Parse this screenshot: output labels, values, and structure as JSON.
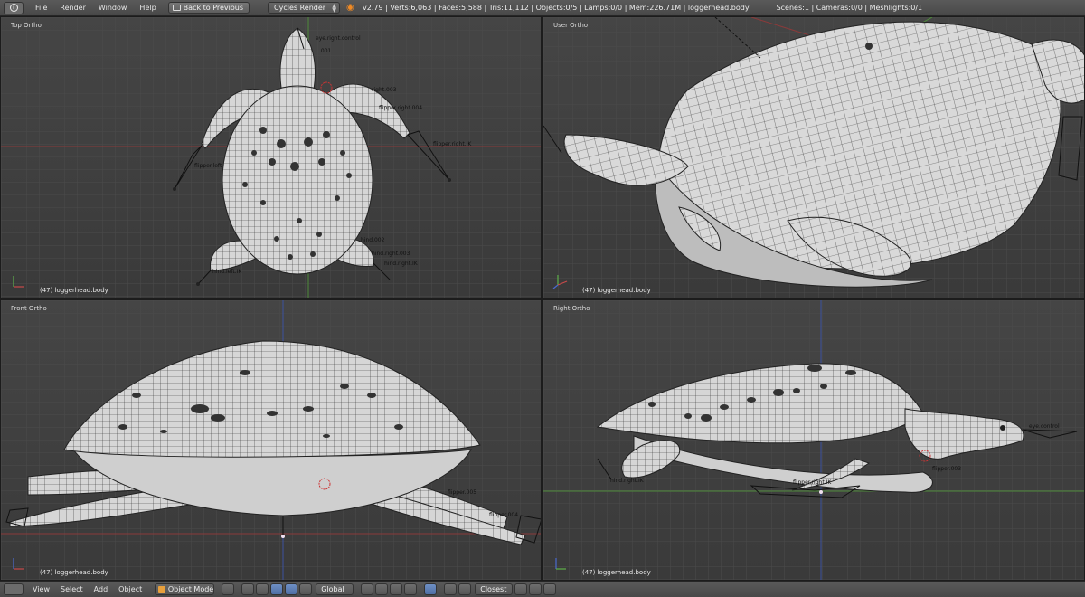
{
  "header": {
    "menus": [
      "File",
      "Render",
      "Window",
      "Help"
    ],
    "back_button": "Back to Previous",
    "render_engine": "Cycles Render",
    "stats": "v2.79 | Verts:6,063 | Faces:5,588 | Tris:11,112 | Objects:0/5 | Lamps:0/0 | Mem:226.71M | loggerhead.body",
    "scene_stats": "Scenes:1 | Cameras:0/0 | Meshlights:0/1"
  },
  "viewports": {
    "top_left": {
      "label": "Top Ortho",
      "object": "(47) loggerhead.body"
    },
    "top_right": {
      "label": "User Ortho",
      "object": "(47) loggerhead.body"
    },
    "bottom_left": {
      "label": "Front Ortho",
      "object": "(47) loggerhead.body"
    },
    "bottom_right": {
      "label": "Right Ortho",
      "object": "(47) loggerhead.body"
    }
  },
  "bone_labels": {
    "top": [
      "eye.right.control",
      ".001",
      "right.003",
      "flipper.right.004",
      "flipper.right.IK",
      "flipper.left",
      "hind.002",
      "hind.right.003",
      "hind.right.IK",
      "hind.left.IK"
    ],
    "front": [
      "flipper.005",
      "flipper.004"
    ],
    "right": [
      "eye.control",
      "hind.right.IK",
      "flipper.right.IK",
      "flipper.003"
    ]
  },
  "footer": {
    "menus": [
      "View",
      "Select",
      "Add",
      "Object"
    ],
    "mode": "Object Mode",
    "orientation": "Global",
    "snap_target": "Closest"
  },
  "colors": {
    "grid_line": "#4b4b4b",
    "x_axis": "#9a3b3b",
    "y_axis": "#4e8a3a",
    "z_axis": "#3c52a0",
    "mesh_fill": "#d8d8d8",
    "mesh_wire": "#2a2a2a",
    "header_bg": "#505050"
  }
}
